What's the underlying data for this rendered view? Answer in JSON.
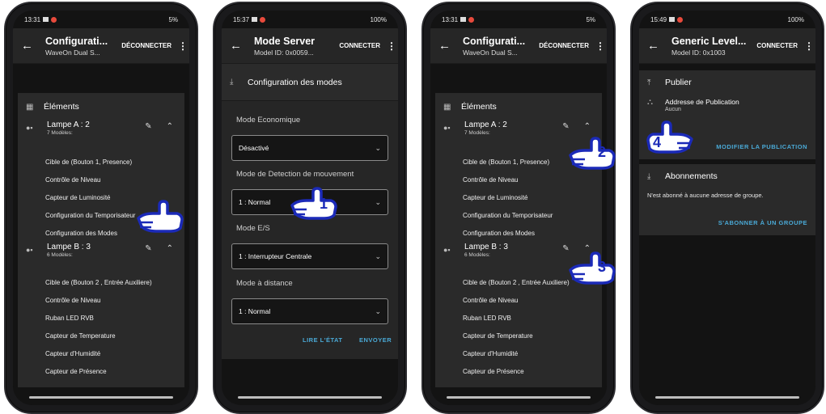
{
  "phone1": {
    "status": {
      "time": "13:31",
      "battery": "5%"
    },
    "appbar": {
      "title": "Configurati...",
      "subtitle": "WaveOn Dual S...",
      "action": "DÉCONNECTER"
    },
    "section_title": "Éléments",
    "groups": [
      {
        "name": "Lampe A : 2",
        "models": "7 Modèles:",
        "items": [
          "Cible de (Bouton 1, Presence)",
          "Contrôle de Niveau",
          "Capteur de Luminosité",
          "Configuration du Temporisateur",
          "Configuration des Modes"
        ]
      },
      {
        "name": "Lampe B : 3",
        "models": "6 Modèles:",
        "items": [
          "Cible de (Bouton 2 , Entrée Auxiliere)",
          "Contrôle de Niveau",
          "Ruban LED RVB",
          "Capteur de Temperature",
          "Capteur d'Humidité",
          "Capteur de Présence"
        ]
      }
    ]
  },
  "phone2": {
    "status": {
      "time": "15:37",
      "battery": "100%"
    },
    "appbar": {
      "title": "Mode Server",
      "subtitle": "Model ID: 0x0059...",
      "action": "CONNECTER"
    },
    "section_title": "Configuration des modes",
    "fields": [
      {
        "label": "Mode Economique",
        "value": "Désactivé"
      },
      {
        "label": "Mode de Detection de mouvement",
        "value": "1 : Normal"
      },
      {
        "label": "Mode E/S",
        "value": "1 : Interrupteur Centrale"
      },
      {
        "label": "Mode à distance",
        "value": "1 : Normal"
      }
    ],
    "buttons": {
      "read": "LIRE L'ÉTAT",
      "send": "ENVOYER"
    }
  },
  "phone3": {
    "status": {
      "time": "13:31",
      "battery": "5%"
    },
    "appbar": {
      "title": "Configurati...",
      "subtitle": "WaveOn Dual S...",
      "action": "DÉCONNECTER"
    },
    "section_title": "Éléments",
    "groups": [
      {
        "name": "Lampe A : 2",
        "models": "7 Modèles:",
        "items": [
          "Cible de (Bouton 1, Presence)",
          "Contrôle de Niveau",
          "Capteur de Luminosité",
          "Configuration du Temporisateur",
          "Configuration des Modes"
        ]
      },
      {
        "name": "Lampe B : 3",
        "models": "6 Modèles:",
        "items": [
          "Cible de (Bouton 2 , Entrée Auxiliere)",
          "Contrôle de Niveau",
          "Ruban LED RVB",
          "Capteur de Temperature",
          "Capteur d'Humidité",
          "Capteur de Présence"
        ]
      }
    ]
  },
  "phone4": {
    "status": {
      "time": "15:49",
      "battery": "100%"
    },
    "appbar": {
      "title": "Generic Level...",
      "subtitle": "Model ID: 0x1003",
      "action": "CONNECTER"
    },
    "publish": {
      "title": "Publier",
      "address_label": "Addresse de Publication",
      "address_value": "Aucun",
      "button": "MODIFIER LA PUBLICATION"
    },
    "subscriptions": {
      "title": "Abonnements",
      "text": "N'est abonné à aucune adresse de groupe.",
      "button": "S'ABONNER À UN GROUPE"
    }
  },
  "steps": [
    "1",
    "2",
    "3",
    "4"
  ],
  "colors": {
    "accent": "#4aa9d6",
    "hand_fill": "#ffffff",
    "hand_outline": "#1b2ab8"
  }
}
